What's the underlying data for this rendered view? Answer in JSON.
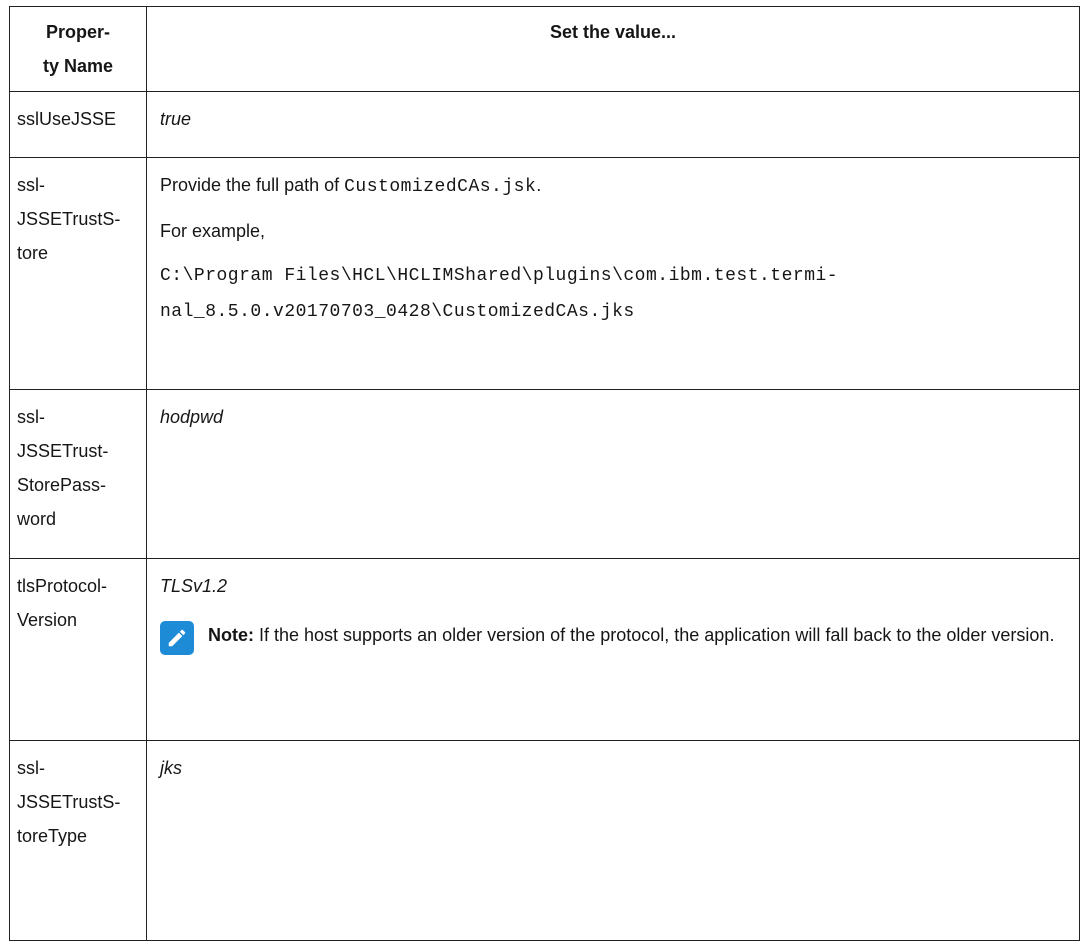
{
  "table": {
    "header": {
      "col1_line1": "Proper-",
      "col1_line2": "ty Name",
      "col2": "Set the value..."
    },
    "rows": [
      {
        "name": "sslUseJSSE",
        "value": "true"
      },
      {
        "name": "ssl-JSSETrustS-tore",
        "name_lines": [
          "ssl-",
          "JSSETrustS-",
          "tore"
        ],
        "value_prefix": "Provide the full path of ",
        "value_code": "CustomizedCAs.jsk",
        "value_suffix": ".",
        "example_label": "For example,",
        "path_line1": "C:\\Program Files\\HCL\\HCLIMShared\\plugins\\com.ibm.test.termi-",
        "path_line2": "nal_8.5.0.v20170703_0428\\CustomizedCAs.jks"
      },
      {
        "name_lines": [
          "ssl-",
          "JSSETrust-",
          "StorePass-",
          "word"
        ],
        "value": "hodpwd"
      },
      {
        "name_lines": [
          "tlsProtocol-",
          "Version"
        ],
        "value": "TLSv1.2",
        "note_label": "Note:",
        "note_text": " If the host supports an older version of the protocol, the application will fall back to the older version."
      },
      {
        "name_lines": [
          "ssl-",
          "JSSETrustS-",
          "toreType"
        ],
        "value": "jks"
      }
    ]
  },
  "colors": {
    "note_icon": "#1d8bd6",
    "border": "#222222",
    "text": "#161616"
  },
  "icons": {
    "note": "pencil-icon"
  }
}
